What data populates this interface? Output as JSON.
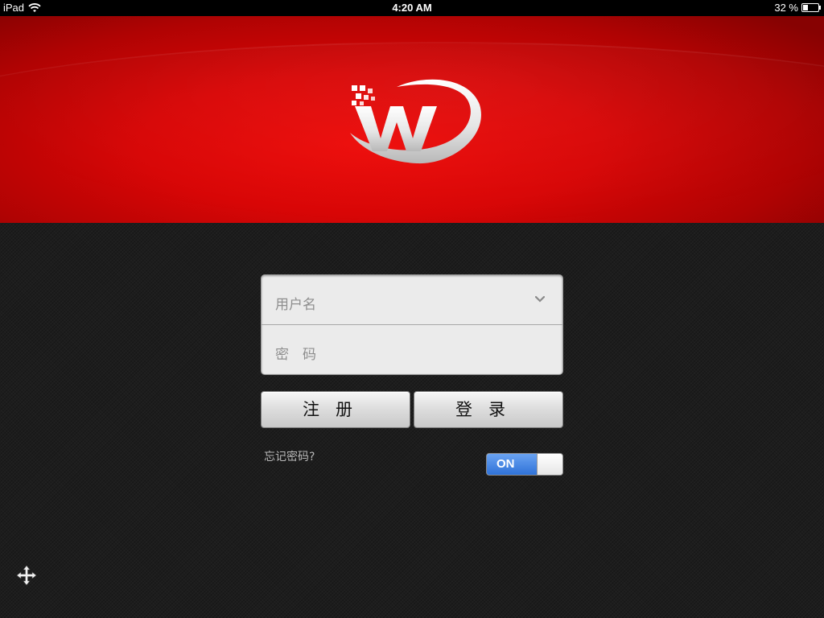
{
  "status_bar": {
    "device": "iPad",
    "time": "4:20 AM",
    "battery_percent_text": "32 %",
    "battery_level": 0.32
  },
  "banner": {
    "logo_icon": "w-logo-icon",
    "accent_color": "#e00606"
  },
  "login_form": {
    "username_placeholder": "用户名",
    "password_placeholder": "密　码"
  },
  "buttons": {
    "register_label": "注册",
    "login_label": "登录"
  },
  "forgot_password_label": "忘记密码?",
  "remember_toggle": {
    "state_label": "ON",
    "on_color": "#2f72d8"
  },
  "icons": {
    "chevron": "chevron-down-icon",
    "move": "move-icon",
    "wifi": "wifi-icon",
    "battery": "battery-icon"
  }
}
